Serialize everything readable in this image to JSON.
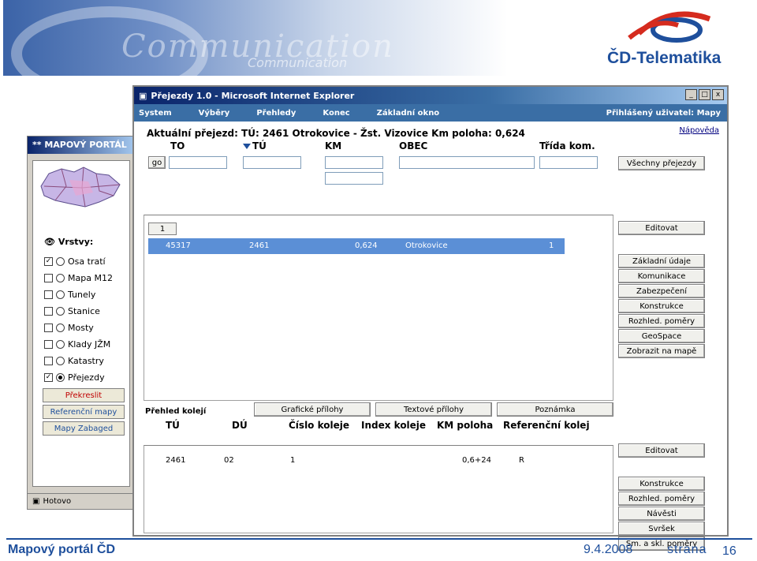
{
  "slide": {
    "banner_text": "Communication",
    "banner_subtext": "Communication",
    "logo_text": "ČD-Telematika",
    "footer_left": "Mapový portál ČD",
    "footer_date": "9.4.2008",
    "footer_strana": "strana",
    "footer_page": "16"
  },
  "bg_window": {
    "title": "** MAPOVÝ PORTÁL",
    "layers_head": "Vrstvy:",
    "layers": [
      {
        "label": "Osa tratí",
        "checked": true,
        "radio": false
      },
      {
        "label": "Mapa M12",
        "checked": false,
        "radio": false
      },
      {
        "label": "Tunely",
        "checked": false,
        "radio": false
      },
      {
        "label": "Stanice",
        "checked": false,
        "radio": false
      },
      {
        "label": "Mosty",
        "checked": false,
        "radio": false
      },
      {
        "label": "Klady JŽM",
        "checked": false,
        "radio": false
      },
      {
        "label": "Katastry",
        "checked": false,
        "radio": false
      },
      {
        "label": "Přejezdy",
        "checked": true,
        "radio": true
      }
    ],
    "buttons": [
      "Překreslit",
      "Referenční mapy",
      "Mapy Zabaged"
    ],
    "status": "Hotovo"
  },
  "window": {
    "title": "Přejezdy 1.0 - Microsoft Internet Explorer",
    "controls": [
      "_",
      "□",
      "x"
    ]
  },
  "menu": {
    "items": [
      "System",
      "Výběry",
      "Přehledy",
      "Konec",
      "Základní okno"
    ],
    "user": "Přihlášený uživatel: Mapy"
  },
  "header": {
    "current": "Aktuální přejezd: TÚ: 2461 Otrokovice - Žst. Vizovice   Km poloha: 0,624",
    "help": "Nápověda"
  },
  "filters": {
    "to": "TO",
    "tu": "TÚ",
    "km": "KM",
    "obec": "OBEC",
    "trida": "Třída kom.",
    "go": "go",
    "all_button": "Všechny přejezdy"
  },
  "result": {
    "tab": "1",
    "row": {
      "to": "45317",
      "tu": "2461",
      "km": "0,624",
      "obec": "Otrokovice",
      "trida": "1"
    }
  },
  "right_buttons_top": [
    "Editovat",
    "Základní údaje",
    "Komunikace",
    "Zabezpečení",
    "Konstrukce",
    "Rozhled. poměry",
    "GeoSpace",
    "Zobrazit na mapě"
  ],
  "kolej": {
    "title": "Přehled kolejí",
    "tabs": [
      "Grafické přílohy",
      "Textové přílohy",
      "Poznámka"
    ],
    "columns": [
      "TÚ",
      "DÚ",
      "Číslo koleje",
      "Index koleje",
      "KM poloha",
      "Referenční kolej"
    ],
    "row": {
      "tu": "2461",
      "du": "02",
      "cislo": "1",
      "km": "0,6+24",
      "ref": "R"
    }
  },
  "right_buttons_bottom": [
    "Editovat",
    "Konstrukce",
    "Rozhled. poměry",
    "Návěsti",
    "Svršek",
    "Sm. a skl. poměry"
  ]
}
